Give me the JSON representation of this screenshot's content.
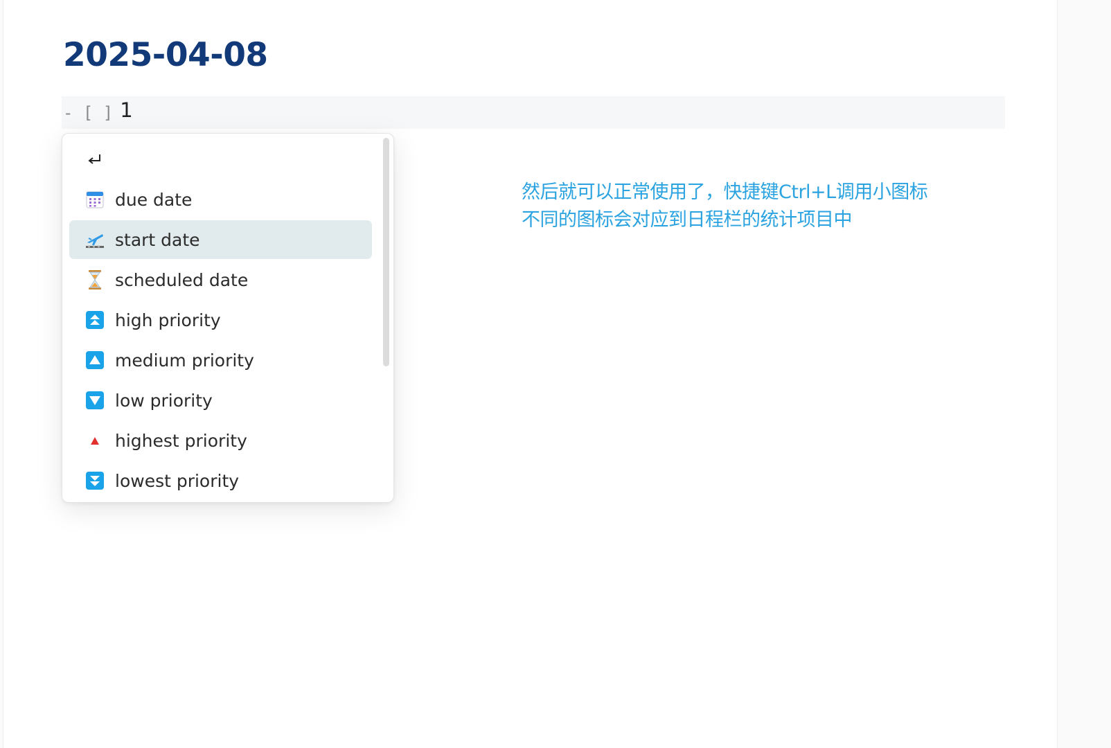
{
  "note": {
    "title": "2025-04-08",
    "task": {
      "marker": "- [ ]",
      "text": "1"
    }
  },
  "suggestions": {
    "selected_index": 2,
    "items": [
      {
        "icon": "return-icon",
        "label": ""
      },
      {
        "icon": "calendar-icon",
        "label": "due date"
      },
      {
        "icon": "airplane-departure-icon",
        "label": "start date"
      },
      {
        "icon": "hourglass-icon",
        "label": "scheduled date"
      },
      {
        "icon": "double-up-arrow-icon",
        "label": "high priority"
      },
      {
        "icon": "up-triangle-icon",
        "label": "medium priority"
      },
      {
        "icon": "down-triangle-icon",
        "label": "low priority"
      },
      {
        "icon": "red-triangle-icon",
        "label": "highest priority"
      },
      {
        "icon": "double-down-arrow-icon",
        "label": "lowest priority"
      }
    ]
  },
  "annotation": {
    "line1": "然后就可以正常使用了，快捷键Ctrl+L调用小图标",
    "line2": "不同的图标会对应到日程栏的统计项目中"
  },
  "colors": {
    "title": "#123a78",
    "annotation": "#2aa3e0",
    "icon_blue": "#1aa3e8",
    "icon_red": "#e03030",
    "selected_row": "#e1eaec"
  }
}
